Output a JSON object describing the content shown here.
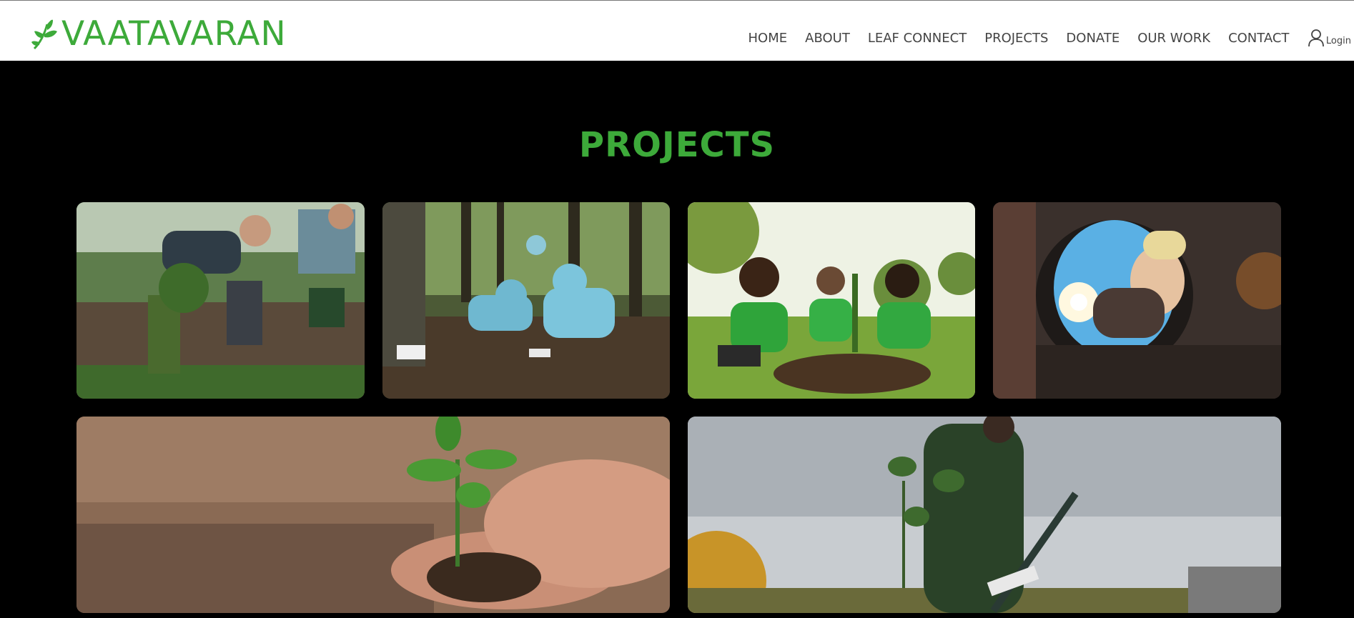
{
  "brand": {
    "name": "VAATAVARAN"
  },
  "colors": {
    "accent": "#3daa3a",
    "nav_text": "#444444",
    "background": "#000000"
  },
  "nav": {
    "items": [
      {
        "label": "HOME"
      },
      {
        "label": "ABOUT"
      },
      {
        "label": "LEAF CONNECT"
      },
      {
        "label": "PROJECTS"
      },
      {
        "label": "DONATE"
      },
      {
        "label": "OUR WORK"
      },
      {
        "label": "CONTACT"
      }
    ],
    "login": {
      "icon": "user-icon",
      "label": "Login"
    }
  },
  "page": {
    "title": "PROJECTS"
  },
  "projects": [
    {
      "image": "volunteers-planting-tree-field"
    },
    {
      "image": "volunteers-planting-in-forest"
    },
    {
      "image": "group-planting-sapling-park"
    },
    {
      "image": "woman-planting-flower-view-from-hole"
    },
    {
      "image": "hands-holding-seedling-soil"
    },
    {
      "image": "man-carrying-sapling-and-shovel"
    }
  ]
}
